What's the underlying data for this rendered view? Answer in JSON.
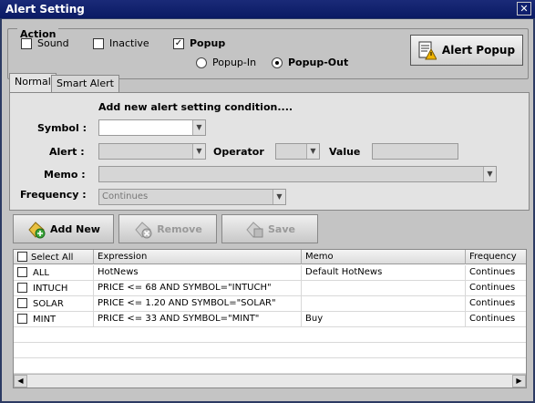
{
  "window": {
    "title": "Alert Setting",
    "close_glyph": "✕"
  },
  "action": {
    "legend": "Action",
    "sound_label": "Sound",
    "sound_checked": false,
    "inactive_label": "Inactive",
    "inactive_checked": false,
    "popup_label": "Popup",
    "popup_checked": true,
    "popup_in_label": "Popup-In",
    "popup_out_label": "Popup-Out",
    "popup_mode": "Popup-Out",
    "alert_popup_button": "Alert Popup"
  },
  "tabs": [
    {
      "label": "Normal",
      "active": true
    },
    {
      "label": "Smart Alert",
      "active": false
    }
  ],
  "form": {
    "heading": "Add new alert setting condition....",
    "symbol_label": "Symbol :",
    "symbol_value": "",
    "alert_label": "Alert :",
    "alert_value": "",
    "operator_label": "Operator",
    "operator_value": "",
    "value_label": "Value",
    "value_value": "",
    "memo_label": "Memo :",
    "memo_value": "",
    "frequency_label": "Frequency :",
    "frequency_value": "Continues"
  },
  "buttons": {
    "add_new": "Add New",
    "remove": "Remove",
    "save": "Save"
  },
  "grid": {
    "headers": {
      "select_all": "Select All",
      "expression": "Expression",
      "memo": "Memo",
      "frequency": "Frequency"
    },
    "rows": [
      {
        "symbol": "ALL",
        "expression": "HotNews",
        "memo": "Default HotNews",
        "frequency": "Continues"
      },
      {
        "symbol": "INTUCH",
        "expression": "PRICE <= 68 AND SYMBOL=\"INTUCH\"",
        "memo": "",
        "frequency": "Continues"
      },
      {
        "symbol": "SOLAR",
        "expression": "PRICE <= 1.20 AND SYMBOL=\"SOLAR\"",
        "memo": "",
        "frequency": "Continues"
      },
      {
        "symbol": "MINT",
        "expression": "PRICE <= 33 AND SYMBOL=\"MINT\"",
        "memo": "Buy",
        "frequency": "Continues"
      }
    ]
  },
  "icons": {
    "alert_popup": "notepad-warning-icon",
    "add": "add-icon",
    "remove": "remove-icon",
    "save": "save-icon"
  },
  "colors": {
    "titlebar": "#0a1a64",
    "client": "#c4c4c4",
    "panel": "#e3e3e3"
  }
}
